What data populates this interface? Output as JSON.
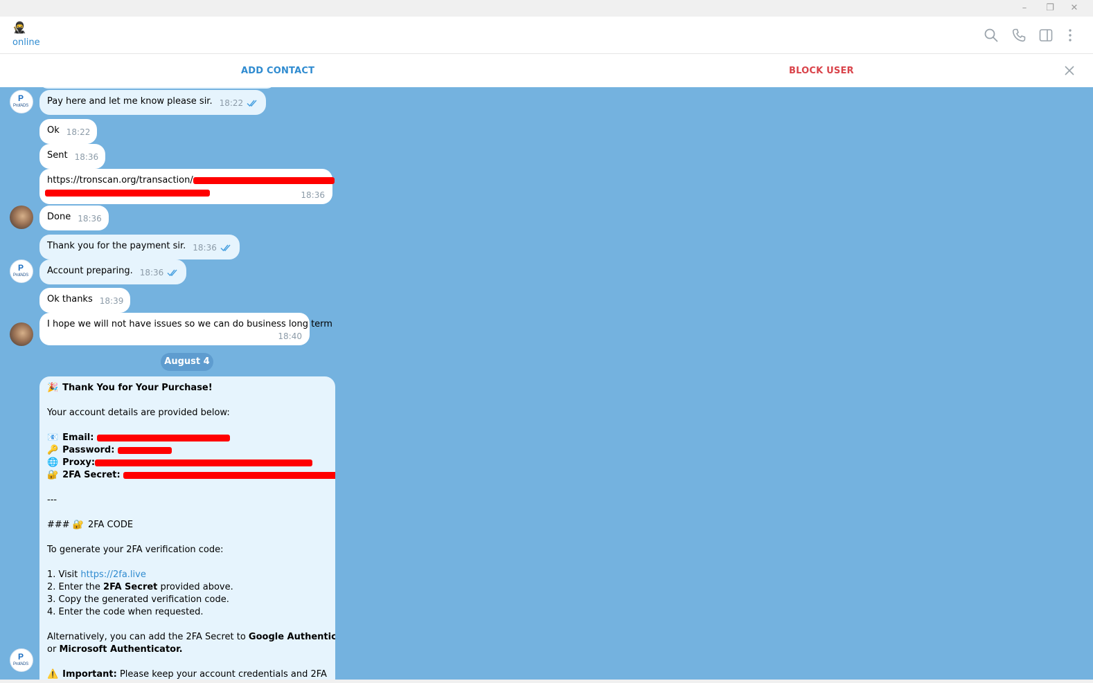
{
  "window": {
    "minimize_glyph": "–",
    "restore_glyph": "❐",
    "close_glyph": "✕"
  },
  "header": {
    "peer_name": "🥷",
    "peer_status": "online",
    "icons": [
      "search-icon",
      "phone-icon",
      "sidebar-toggle-icon",
      "more-vert-icon"
    ]
  },
  "action_bar": {
    "add_contact": "ADD CONTACT",
    "block_user": "BLOCK USER",
    "close_glyph": "✕"
  },
  "colors": {
    "chat_bg": "#74b2df",
    "accent": "#2f8bd0",
    "danger": "#d9434a",
    "outgoing": "#e6f4fd",
    "redaction": "#ff0000"
  },
  "messages": [
    {
      "text": "Pay here and let me know please sir.",
      "time": "18:22",
      "read": true
    },
    {
      "text": "Ok",
      "time": "18:22"
    },
    {
      "text": "Sent",
      "time": "18:36"
    },
    {
      "text": "https://tronscan.org/transaction/",
      "time": "18:36"
    },
    {
      "text": "Done",
      "time": "18:36"
    },
    {
      "text": "Thank you for the payment sir.",
      "time": "18:36",
      "read": true
    },
    {
      "text": "Account preparing.",
      "time": "18:36",
      "read": true
    },
    {
      "text": "Ok thanks",
      "time": "18:39"
    },
    {
      "text": "I hope we will not have issues so we can do business long term",
      "time": "18:40"
    }
  ],
  "date_separator": "August 4",
  "purchase_message": {
    "title_emoji": "🎉",
    "title": "Thank You for Your Purchase!",
    "intro": "Your account details are provided below:",
    "email_emoji": "📧",
    "email_label": "Email:",
    "password_emoji": "🔑",
    "password_label": "Password:",
    "proxy_emoji": "🌐",
    "proxy_label": "Proxy:",
    "secret_emoji": "🔐",
    "secret_label": "2FA Secret:",
    "divider": "---",
    "heading_prefix": "###",
    "heading_emoji": "🔐",
    "heading_text": "2FA CODE",
    "generate_intro": "To generate your 2FA verification code:",
    "step1_prefix": "1. Visit ",
    "step1_link": "https://2fa.live",
    "step2_prefix": "2. Enter the ",
    "step2_bold": "2FA Secret",
    "step2_suffix": " provided above.",
    "step3": "3. Copy the generated verification code.",
    "step4": "4. Enter the code when requested.",
    "alt_prefix": "Alternatively, you can add the 2FA Secret to ",
    "alt_bold1": "Google Authenticator",
    "alt_mid": "or ",
    "alt_bold2": "Microsoft Authenticator.",
    "important_emoji": "⚠️",
    "important_label": "Important:",
    "important_text": " Please keep your account credentials and 2FA"
  },
  "avatar_logo_text": {
    "mark": "P",
    "name": "ProfADS"
  }
}
